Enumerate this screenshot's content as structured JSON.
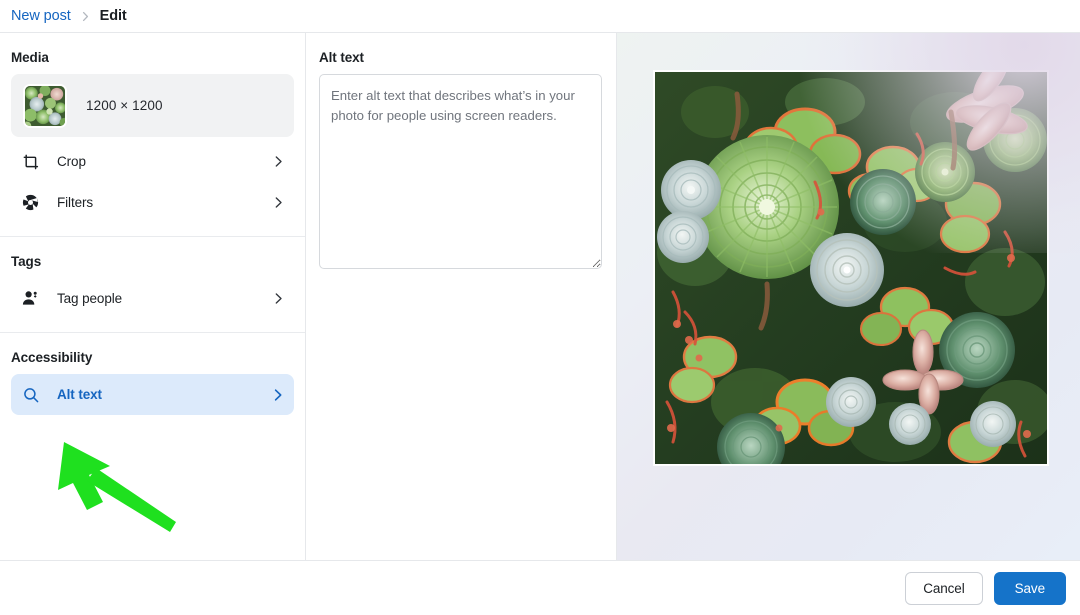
{
  "breadcrumb": {
    "parent_label": "New post",
    "separator": "›",
    "current_label": "Edit"
  },
  "sidebar": {
    "sections": [
      {
        "title": "Media",
        "media_card": {
          "dimensions": "1200 × 1200",
          "thumbnail_icon": "succulent-photo-thumbnail"
        },
        "rows": [
          {
            "label": "Crop",
            "icon": "crop-icon",
            "chevron": "chevron-right-icon",
            "active": false
          },
          {
            "label": "Filters",
            "icon": "aperture-icon",
            "chevron": "chevron-right-icon",
            "active": false
          }
        ]
      },
      {
        "title": "Tags",
        "rows": [
          {
            "label": "Tag people",
            "icon": "person-add-icon",
            "chevron": "chevron-right-icon",
            "active": false
          }
        ]
      },
      {
        "title": "Accessibility",
        "rows": [
          {
            "label": "Alt text",
            "icon": "search-icon",
            "chevron": "chevron-right-icon",
            "active": true
          }
        ]
      }
    ]
  },
  "alt_text_panel": {
    "title": "Alt text",
    "textarea_value": "",
    "textarea_placeholder": "Enter alt text that describes what’s in your photo for people using screen readers."
  },
  "preview": {
    "image_name": "succulent-garden-photo",
    "image_alt": "Overhead photo of densely packed green, blue-grey and pink succulent rosettes"
  },
  "footer": {
    "cancel_label": "Cancel",
    "save_label": "Save"
  },
  "annotation": {
    "type": "arrow",
    "color": "#1fe01f",
    "points_to": "Alt text row in Accessibility section"
  },
  "colors": {
    "accent_blue": "#1565c0",
    "save_button": "#1573c9",
    "active_row_bg": "#dceafb",
    "media_card_bg": "#f1f2f3",
    "annotation_green": "#1fe01f"
  }
}
